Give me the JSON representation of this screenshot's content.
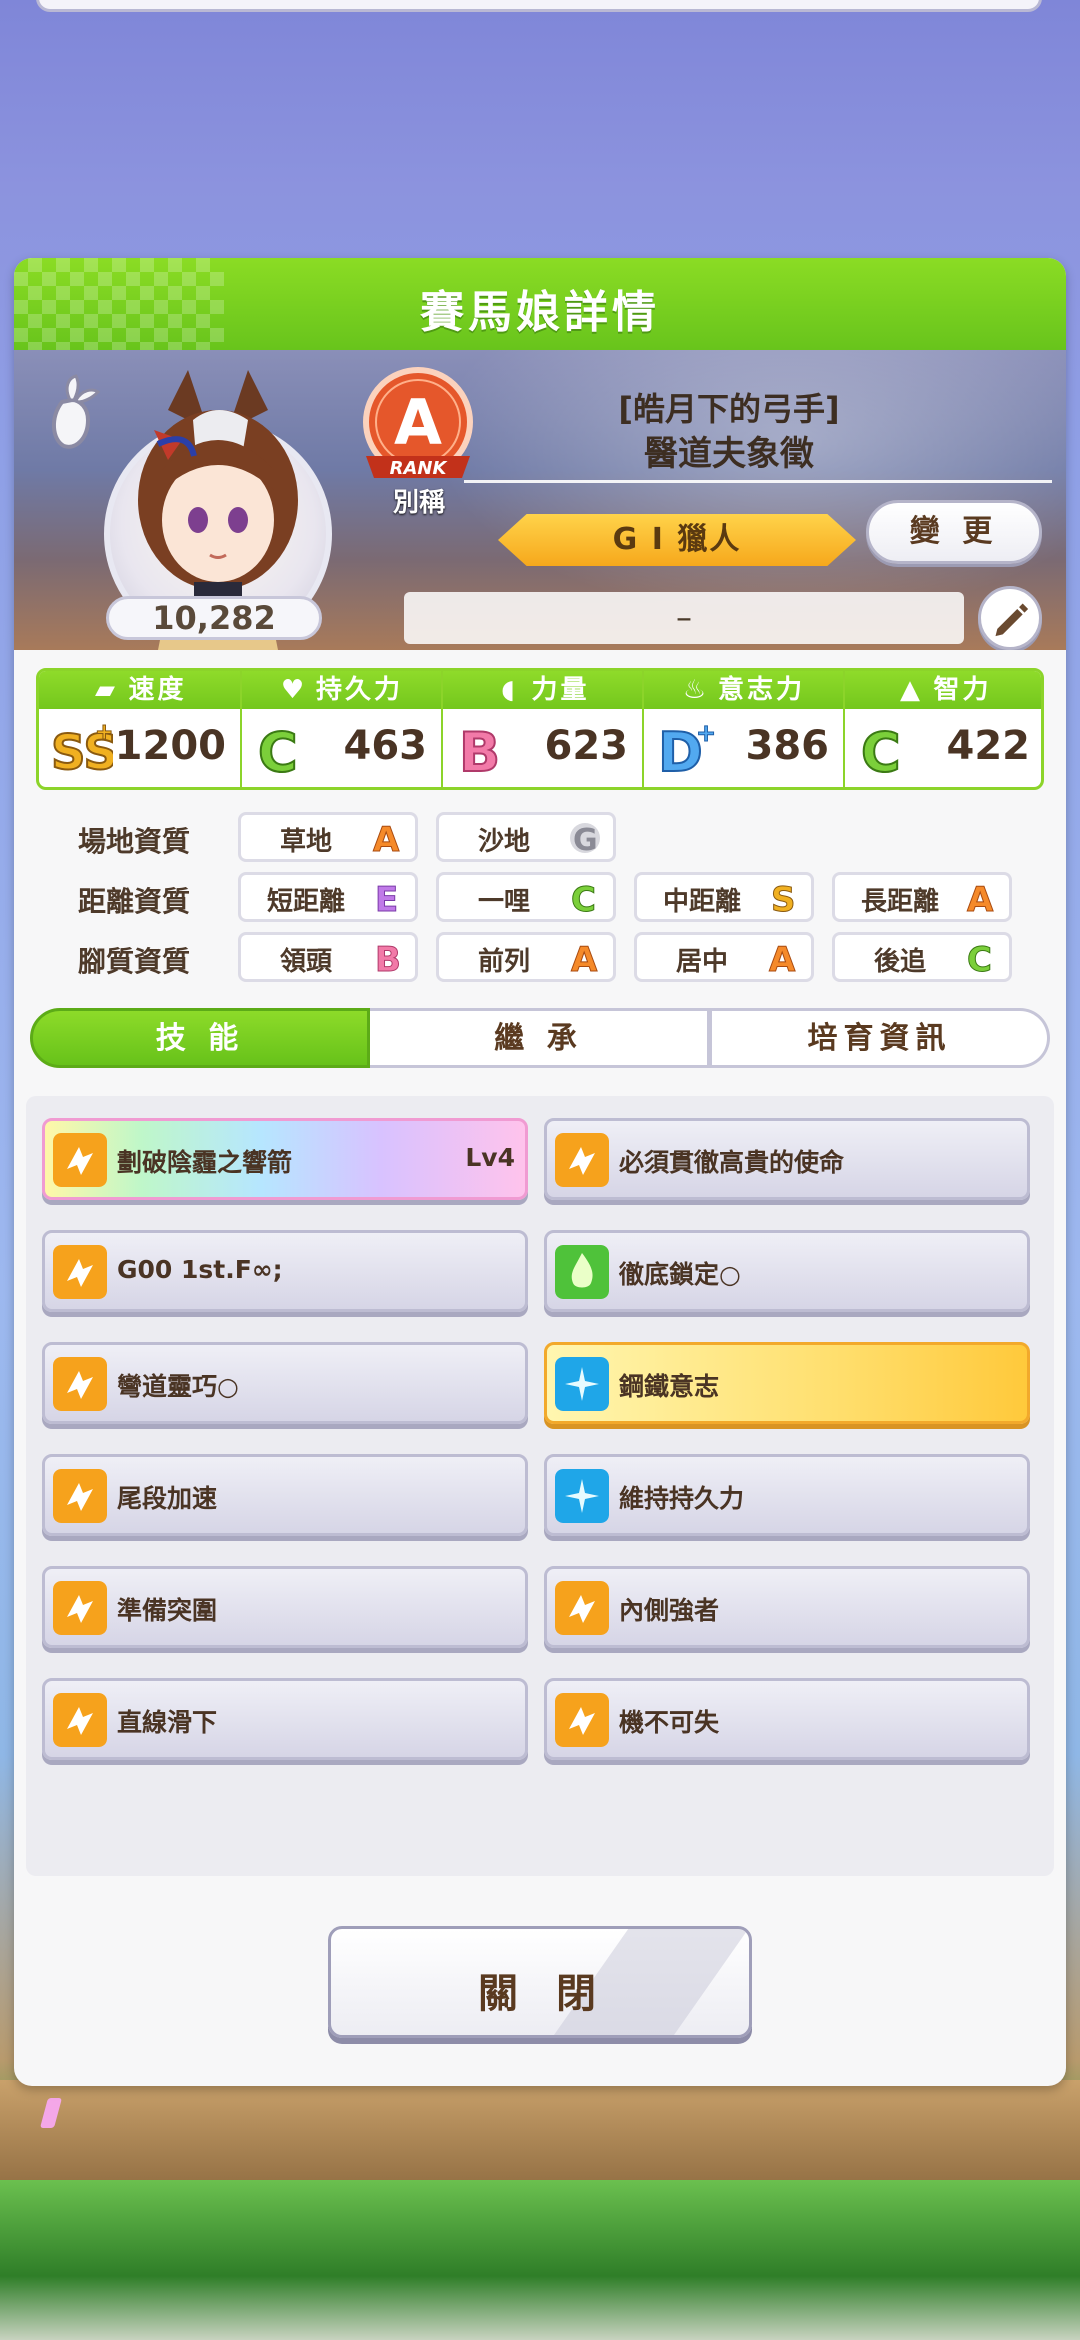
{
  "panel": {
    "title": "賽馬娘詳情"
  },
  "profile": {
    "fans": "10,282",
    "rank_label": "別稱",
    "rank_letter": "A",
    "rank_word": "RANK",
    "epithet": "[皓月下的弓手]",
    "character_name": "醫道夫象徵",
    "title_banner": "G I 獵人",
    "change_button": "變 更",
    "comment": "–"
  },
  "stats": [
    {
      "label": "速度",
      "grade": "SS+",
      "value": "1200",
      "icon": "shoe-icon"
    },
    {
      "label": "持久力",
      "grade": "C",
      "value": "463",
      "icon": "heart-icon"
    },
    {
      "label": "力量",
      "grade": "B",
      "value": "623",
      "icon": "muscle-icon"
    },
    {
      "label": "意志力",
      "grade": "D+",
      "value": "386",
      "icon": "flame-icon"
    },
    {
      "label": "智力",
      "grade": "C",
      "value": "422",
      "icon": "graduation-cap-icon"
    }
  ],
  "aptitude": {
    "track": {
      "label": "場地資質",
      "items": [
        {
          "label": "草地",
          "grade": "A"
        },
        {
          "label": "沙地",
          "grade": "G"
        }
      ]
    },
    "distance": {
      "label": "距離資質",
      "items": [
        {
          "label": "短距離",
          "grade": "E"
        },
        {
          "label": "一哩",
          "grade": "C"
        },
        {
          "label": "中距離",
          "grade": "S"
        },
        {
          "label": "長距離",
          "grade": "A"
        }
      ]
    },
    "style": {
      "label": "腳質資質",
      "items": [
        {
          "label": "領頭",
          "grade": "B"
        },
        {
          "label": "前列",
          "grade": "A"
        },
        {
          "label": "居中",
          "grade": "A"
        },
        {
          "label": "後追",
          "grade": "C"
        }
      ]
    }
  },
  "tabs": {
    "skills": "技 能",
    "inherit": "繼 承",
    "info": "培育資訊"
  },
  "skills": [
    {
      "name": "劃破陰霾之響箭",
      "level": "Lv4",
      "style": "rainbow",
      "icon": "speed-skill-icon"
    },
    {
      "name": "必須貫徹高貴的使命",
      "style": "normal",
      "icon": "speed-skill-icon"
    },
    {
      "name": "G00 1st.F∞;",
      "style": "normal",
      "icon": "speed-skill-icon"
    },
    {
      "name": "徹底鎖定○",
      "style": "normal",
      "icon": "debuff-skill-icon"
    },
    {
      "name": "彎道靈巧○",
      "style": "normal",
      "icon": "speed-skill-icon"
    },
    {
      "name": "鋼鐵意志",
      "style": "gold",
      "icon": "recovery-skill-icon"
    },
    {
      "name": "尾段加速",
      "style": "normal",
      "icon": "speed-skill-icon"
    },
    {
      "name": "維持持久力",
      "style": "normal",
      "icon": "recovery-skill-icon"
    },
    {
      "name": "準備突圍",
      "style": "normal",
      "icon": "speed-skill-icon"
    },
    {
      "name": "內側強者",
      "style": "normal",
      "icon": "speed-skill-icon"
    },
    {
      "name": "直線滑下",
      "style": "normal",
      "icon": "speed-skill-icon"
    },
    {
      "name": "機不可失",
      "style": "normal",
      "icon": "speed-skill-icon"
    }
  ],
  "close_button": "關 閉",
  "colors": {
    "green": "#74c71d",
    "brown_text": "#4a3424",
    "gold": "#f6a81c",
    "rank_orange": "#e8572a"
  }
}
